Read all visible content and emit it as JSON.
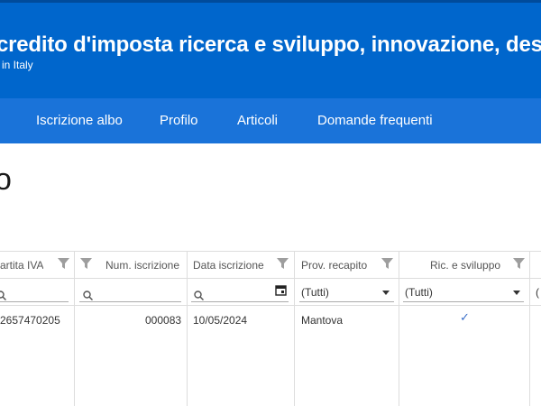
{
  "header": {
    "title": "credito d'imposta ricerca e sviluppo, innovazione, design",
    "subtitle": "in Italy"
  },
  "nav": {
    "items": [
      "Iscrizione albo",
      "Profilo",
      "Articoli",
      "Domande frequenti"
    ]
  },
  "page": {
    "title": "o"
  },
  "grid": {
    "columns": [
      {
        "label": "artita IVA",
        "filter": "search"
      },
      {
        "label": "Num. iscrizione",
        "filter": "search"
      },
      {
        "label": "Data iscrizione",
        "filter": "date"
      },
      {
        "label": "Prov. recapito",
        "filter": "select",
        "selected": "(Tutti)"
      },
      {
        "label": "Ric. e sviluppo",
        "filter": "select",
        "selected": "(Tutti)"
      },
      {
        "label": "",
        "filter": "select",
        "selected": "("
      }
    ],
    "rows": [
      {
        "partita_iva": "2657470205",
        "num_iscrizione": "000083",
        "data_iscrizione": "10/05/2024",
        "prov_recapito": "Mantova",
        "ric_sviluppo_check": "✓"
      }
    ]
  },
  "colors": {
    "header_bg": "#0066cc",
    "nav_bg": "#1a73d9",
    "accent_check": "#3b6fc9"
  },
  "icons": [
    "filter-icon",
    "search-icon",
    "calendar-icon",
    "dropdown-caret-icon",
    "checkmark-icon"
  ]
}
